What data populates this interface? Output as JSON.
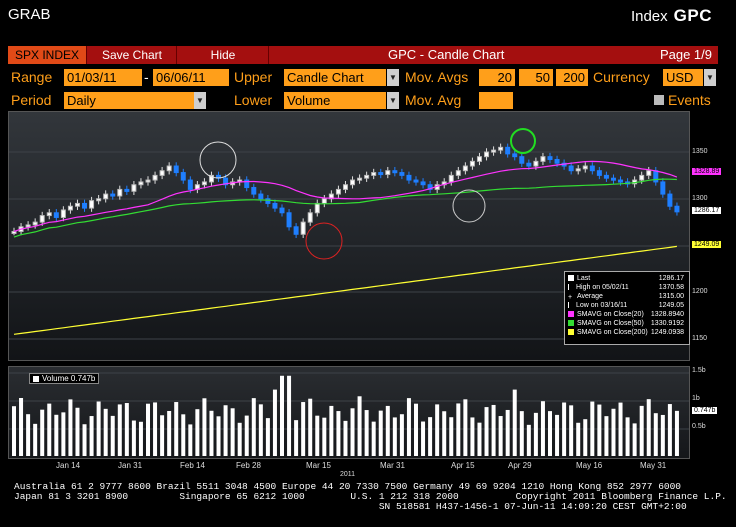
{
  "header": {
    "left": "GRAB",
    "index_label": "Index",
    "ticker": "GPC"
  },
  "titlebar": {
    "spx_button": "SPX INDEX",
    "save_button": "Save Chart",
    "hide_button": "Hide",
    "title": "GPC - Candle Chart",
    "page": "Page 1/9"
  },
  "controls": {
    "range_label": "Range",
    "range_start": "01/03/11",
    "range_sep": "-",
    "range_end": "06/06/11",
    "upper_label": "Upper",
    "upper_value": "Candle Chart",
    "movavgs_label": "Mov. Avgs",
    "ma1": "20",
    "ma2": "50",
    "ma3": "200",
    "currency_label": "Currency",
    "currency_value": "USD",
    "period_label": "Period",
    "period_value": "Daily",
    "lower_label": "Lower",
    "lower_value": "Volume",
    "movavg_label": "Mov. Avg",
    "movavg_value": "",
    "events_label": "Events"
  },
  "price_axis": {
    "ticks": [
      "1350",
      "1300",
      "1250",
      "1200",
      "1150"
    ],
    "tags": {
      "smavg20": "1328.89",
      "last": "1286.17",
      "smavg200": "1249.09"
    }
  },
  "volume_axis": {
    "ticks": [
      "1.5b",
      "1b",
      "0.5b"
    ],
    "tag": "0.747b",
    "label": "Volume 0.747b"
  },
  "legend": {
    "rows": [
      {
        "label": "Last",
        "value": "1286.17",
        "color": "#ffffff"
      },
      {
        "label": "High on 05/02/11",
        "value": "1370.58",
        "color": "#ffffff"
      },
      {
        "label": "Average",
        "value": "1315.00",
        "color": "#ffffff"
      },
      {
        "label": "Low on 03/16/11",
        "value": "1249.05",
        "color": "#ffffff"
      },
      {
        "label": "SMAVG on Close(20)",
        "value": "1328.8940",
        "color": "#ff33ff"
      },
      {
        "label": "SMAVG on Close(50)",
        "value": "1330.9192",
        "color": "#33dd33"
      },
      {
        "label": "SMAVG on Close(200)",
        "value": "1249.0938",
        "color": "#ffff33"
      }
    ]
  },
  "x_axis": {
    "labels": [
      "Jan 14",
      "Jan 31",
      "Feb 14",
      "Feb 28",
      "Mar 15",
      "Mar 31",
      "Apr 15",
      "Apr 29",
      "May 16",
      "May 31"
    ],
    "year": "2011"
  },
  "footer": {
    "line1": "Australia 61 2 9777 8600 Brazil 5511 3048 4500 Europe 44 20 7330 7500 Germany 49 69 9204 1210 Hong Kong 852 2977 6000",
    "line2": "Japan 81 3 3201 8900         Singapore 65 6212 1000        U.S. 1 212 318 2000          Copyright 2011 Bloomberg Finance L.P.",
    "line3": "                                                                SN 518581 H437-1456-1 07-Jun-11 14:09:20 CEST GMT+2:00"
  },
  "colors": {
    "orange": "#ff9f1a",
    "red_bar": "#a40f0f",
    "candle_up": "#ffffff",
    "candle_down": "#1f7fff",
    "ma20": "#ff33ff",
    "ma50": "#33dd33",
    "ma200": "#ffff33"
  }
}
